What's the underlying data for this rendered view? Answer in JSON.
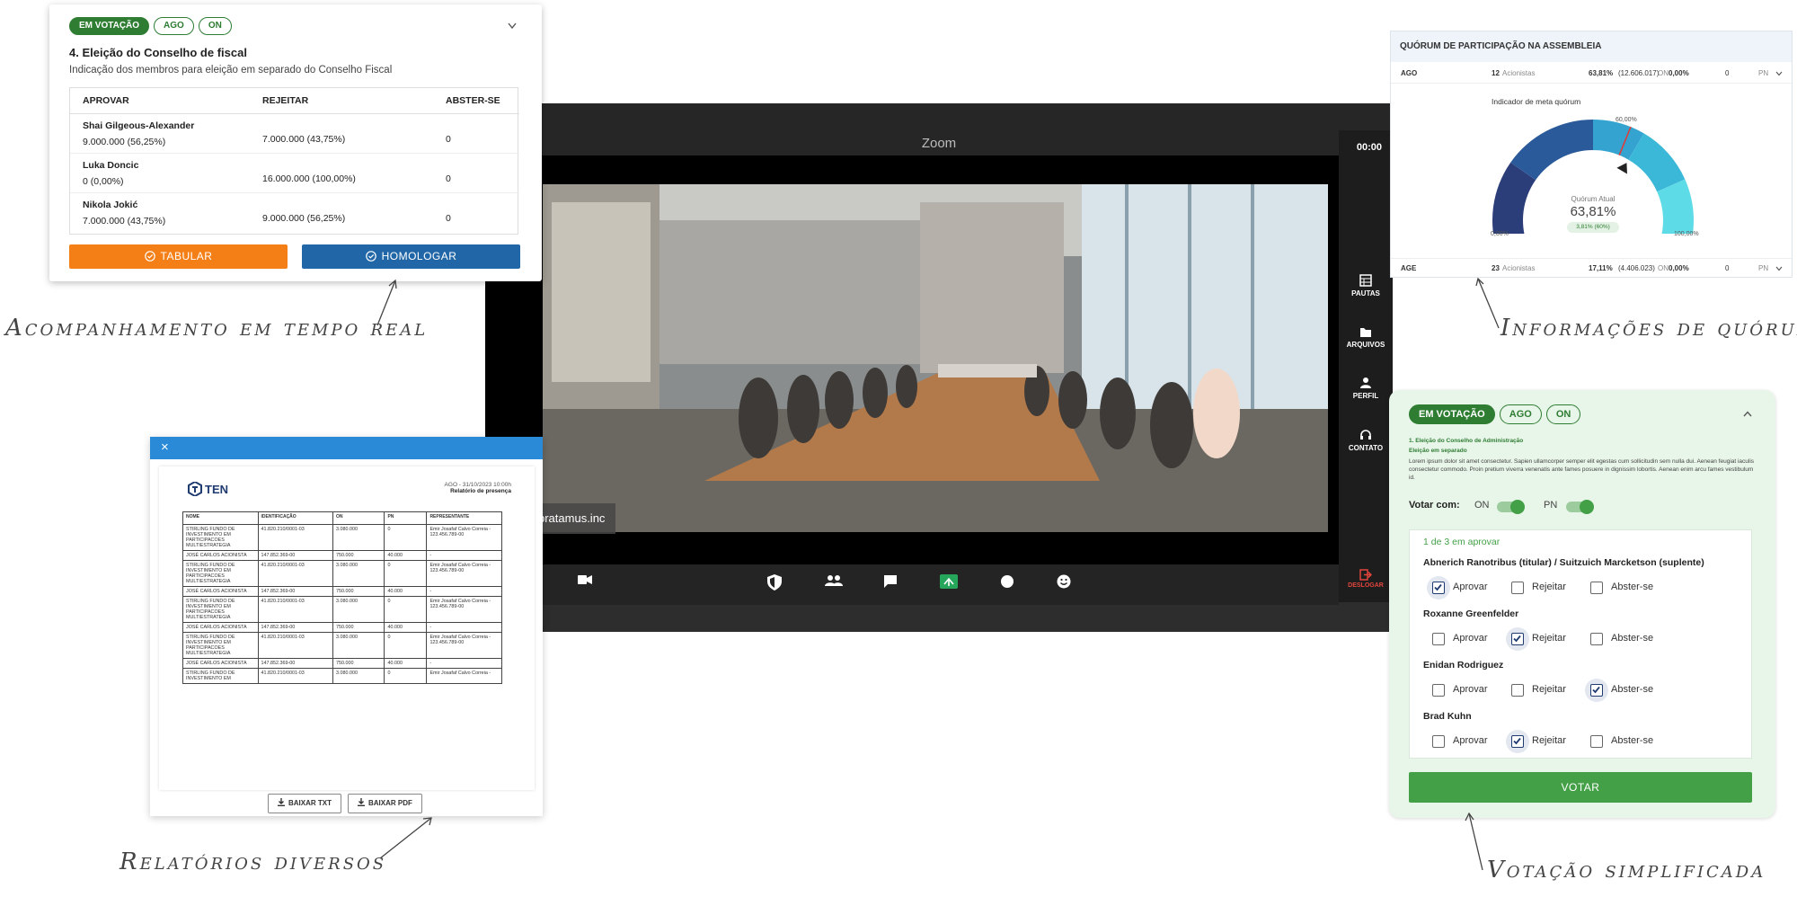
{
  "zoom": {
    "title": "Zoom",
    "timer": "00:00",
    "company_tag": "pratamus.inc",
    "sidebar": [
      {
        "label": "PAUTAS",
        "icon": "agenda-icon"
      },
      {
        "label": "ARQUIVOS",
        "icon": "folder-icon"
      },
      {
        "label": "PERFIL",
        "icon": "person-icon"
      },
      {
        "label": "CONTATO",
        "icon": "headset-icon"
      }
    ],
    "leave_label": "DESLOGAR"
  },
  "card": {
    "pills": [
      "EM VOTAÇÃO",
      "AGO",
      "ON"
    ],
    "title": "4. Eleição do Conselho de fiscal",
    "subtitle": "Indicação dos membros para eleição em separado do Conselho Fiscal",
    "columns": [
      "APROVAR",
      "REJEITAR",
      "ABSTER-SE"
    ],
    "rows": [
      {
        "name": "Shai Gilgeous-Alexander",
        "approve": "9.000.000 (56,25%)",
        "reject": "7.000.000 (43,75%)",
        "abstain": "0"
      },
      {
        "name": "Luka Doncic",
        "approve": "0 (0,00%)",
        "reject": "16.000.000 (100,00%)",
        "abstain": "0"
      },
      {
        "name": "Nikola Jokić",
        "approve": "7.000.000 (43,75%)",
        "reject": "9.000.000 (56,25%)",
        "abstain": "0"
      }
    ],
    "btn_tabular": "TABULAR",
    "btn_homologar": "HOMOLOGAR",
    "tabular_color": "#f57f17",
    "homologar_color": "#2167a8"
  },
  "quorum": {
    "title": "QUÓRUM DE PARTICIPAÇÃO NA ASSEMBLEIA",
    "rows": [
      {
        "type": "AGO",
        "count": "12",
        "count_label": "Acionistas",
        "pct": "63,81%",
        "shares": "(12.606.017)",
        "class": "ON",
        "class_pct": "0,00%",
        "zero": "0",
        "pn": "PN"
      },
      {
        "type": "AGE",
        "count": "23",
        "count_label": "Acionistas",
        "pct": "17,11%",
        "shares": "(4.406.023)",
        "class": "ON",
        "class_pct": "0,00%",
        "zero": "0",
        "pn": "PN"
      }
    ],
    "gauge": {
      "title": "Indicador de meta quórum",
      "label_min": "0,00%",
      "label_target": "60,00%",
      "label_max": "100,00%",
      "current_label": "Quórum Atual",
      "current_value": "63,81%",
      "badge": "3,81% (60%)",
      "value": 63.81,
      "target": 60
    }
  },
  "vote": {
    "pills": [
      "EM VOTAÇÃO",
      "AGO",
      "ON"
    ],
    "item_title": "1. Eleição do Conselho de Administração",
    "item_sub": "Eleição em separado",
    "lorem": "Lorem ipsum dolor sit amet consectetur. Sapien ullamcorper semper elit egestas cum sollicitudin sem nulla dui. Aenean feugiat iaculis consectetur commodo. Proin pretium viverra venenatis ante fames posuere in dignissim lobortis. Aenean enim arcu fames vestibulum id.",
    "vote_with_label": "Votar com:",
    "toggle_on": "ON",
    "toggle_pn": "PN",
    "progress": "1 de 3 em aprovar",
    "options": [
      "Aprovar",
      "Rejeitar",
      "Abster-se"
    ],
    "candidates": [
      {
        "name": "Abnerich Ranotribus (titular) / Suitzuich Marcketson (suplente)",
        "selected": 0
      },
      {
        "name": "Roxanne Greenfelder",
        "selected": 1
      },
      {
        "name": "Enidan Rodriguez",
        "selected": 2
      },
      {
        "name": "Brad Kuhn",
        "selected": 1
      }
    ],
    "submit": "VOTAR",
    "accent": "#43a047"
  },
  "report": {
    "logo": "TEN",
    "meta_line": "AGO - 31/10/2023 10:00h",
    "meta_title": "Relatório de presença",
    "columns": [
      "NOME",
      "IDENTIFICAÇÃO",
      "ON",
      "PN",
      "REPRESENTANTE"
    ],
    "rows": [
      [
        "STIRLING FUNDO DE INVESTIMENTO EM PARTICIPACOES MULTIESTRATEGIA",
        "41.820.210/0001-03",
        "3.080.000",
        "0",
        "Emir Josafaf Calvo Correia - 123.456.789-00"
      ],
      [
        "JOSÉ CARLOS ACIONISTA",
        "147.852.369-00",
        "750.000",
        "40.000",
        "-"
      ],
      [
        "STIRLING FUNDO DE INVESTIMENTO EM PARTICIPACOES MULTIESTRATEGIA",
        "41.820.210/0001-03",
        "3.080.000",
        "0",
        "Emir Josafaf Calvo Correia - 123.456.789-00"
      ],
      [
        "JOSÉ CARLOS ACIONISTA",
        "147.852.369-00",
        "750.000",
        "40.000",
        "-"
      ],
      [
        "STIRLING FUNDO DE INVESTIMENTO EM PARTICIPACOES MULTIESTRATEGIA",
        "41.820.210/0001-03",
        "3.080.000",
        "0",
        "Emir Josafaf Calvo Correia - 123.456.789-00"
      ],
      [
        "JOSÉ CARLOS ACIONISTA",
        "147.852.369-00",
        "750.000",
        "40.000",
        "-"
      ],
      [
        "STIRLING FUNDO DE INVESTIMENTO EM PARTICIPACOES MULTIESTRATEGIA",
        "41.820.210/0001-03",
        "3.080.000",
        "0",
        "Emir Josafaf Calvo Correia - 123.456.789-00"
      ],
      [
        "JOSÉ CARLOS ACIONISTA",
        "147.852.369-00",
        "750.000",
        "40.000",
        "-"
      ],
      [
        "STIRLING FUNDO DE INVESTIMENTO EM",
        "41.820.210/0001-03",
        "3.080.000",
        "0",
        "Emir Josafaf Calvo Correia -"
      ]
    ],
    "btn_txt": "BAIXAR TXT",
    "btn_pdf": "BAIXAR PDF",
    "close": "×"
  },
  "captions": {
    "realtime": "Acompanhamento em tempo real",
    "quorum": "Informações de quórum",
    "reports": "Relatórios diversos",
    "voting": "Votação simplificada"
  }
}
